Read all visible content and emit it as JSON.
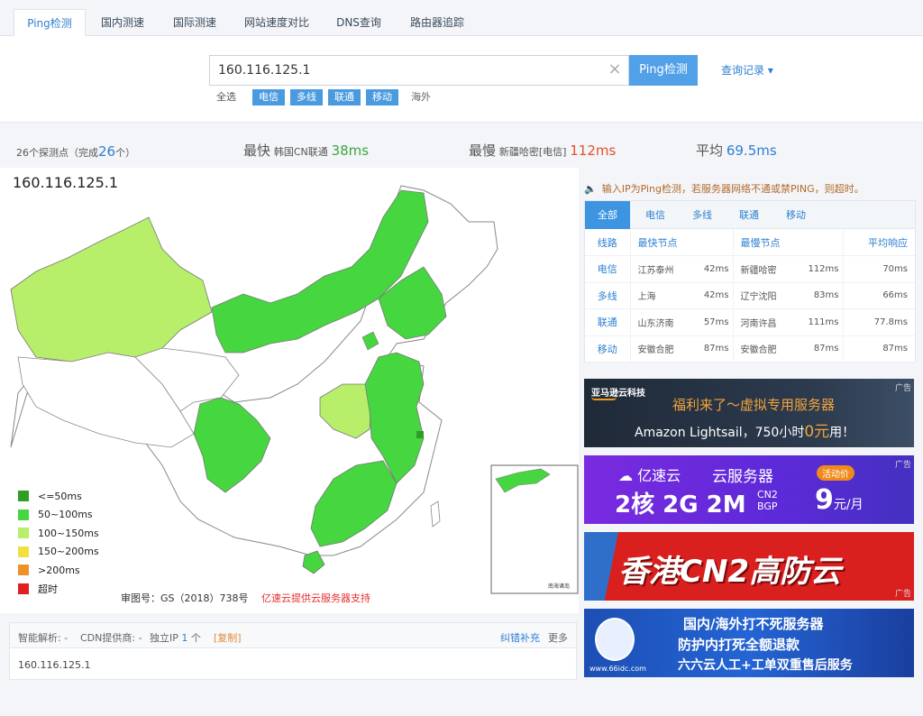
{
  "tabs": [
    "Ping检测",
    "国内测速",
    "国际测速",
    "网站速度对比",
    "DNS查询",
    "路由器追踪"
  ],
  "search": {
    "value": "160.116.125.1",
    "clear": "×",
    "button": "Ping检测",
    "history": "查询记录 ▾"
  },
  "filters": [
    "全选",
    "电信",
    "多线",
    "联通",
    "移动",
    "海外"
  ],
  "stats": {
    "probe_prefix": "26个探测点（完成",
    "probe_done": "26",
    "probe_suffix": "个）",
    "fastest_label": "最快",
    "fastest_node": "韩国CN联通",
    "fastest_value": "38ms",
    "slowest_label": "最慢",
    "slowest_node": "新疆哈密[电信]",
    "slowest_value": "112ms",
    "avg_label": "平均",
    "avg_value": "69.5ms"
  },
  "map": {
    "ip": "160.116.125.1",
    "legend": [
      {
        "label": "<=50ms",
        "color": "#2e9e26"
      },
      {
        "label": "50~100ms",
        "color": "#45d640"
      },
      {
        "label": "100~150ms",
        "color": "#b8ef6a"
      },
      {
        "label": "150~200ms",
        "color": "#f0e040"
      },
      {
        "label": ">200ms",
        "color": "#f0902a"
      },
      {
        "label": "超时",
        "color": "#e02020"
      }
    ],
    "approval": "审图号：GS（2018）738号",
    "powered": "亿速云提供云服务器支持",
    "island_label": "南海诸岛"
  },
  "ipinfo": {
    "smart": "智能解析: -",
    "cdn": "CDN提供商: -",
    "ip_prefix": "独立IP",
    "ip_count": "1",
    "ip_suffix": "个",
    "copy": "[复制]",
    "report": "纠错补充",
    "more": "更多",
    "ip": "160.116.125.1"
  },
  "notice": "输入IP为Ping检测，若服务器网络不通或禁PING，则超时。",
  "results": {
    "tabs": [
      "全部",
      "电信",
      "多线",
      "联通",
      "移动"
    ],
    "headers": {
      "line": "线路",
      "fast": "最快节点",
      "slow": "最慢节点",
      "avg": "平均响应"
    },
    "rows": [
      {
        "line": "电信",
        "fast_node": "江苏泰州",
        "fast_ms": "42ms",
        "slow_node": "新疆哈密",
        "slow_ms": "112ms",
        "avg": "70ms"
      },
      {
        "line": "多线",
        "fast_node": "上海",
        "fast_ms": "42ms",
        "slow_node": "辽宁沈阳",
        "slow_ms": "83ms",
        "avg": "66ms"
      },
      {
        "line": "联通",
        "fast_node": "山东济南",
        "fast_ms": "57ms",
        "slow_node": "河南许昌",
        "slow_ms": "111ms",
        "avg": "77.8ms"
      },
      {
        "line": "移动",
        "fast_node": "安徽合肥",
        "fast_ms": "87ms",
        "slow_node": "安徽合肥",
        "slow_ms": "87ms",
        "avg": "87ms"
      }
    ]
  },
  "ads": [
    {
      "brand": "亚马逊云科技",
      "line1": "福利来了～虚拟专用服务器",
      "line2a": "Amazon Lightsail，750小时",
      "line2b": "0元",
      "line2c": "用！",
      "tag": "广告"
    },
    {
      "brand": "亿速云",
      "product": "云服务器",
      "badge": "活动价",
      "spec": "2核 2G 2M",
      "net1": "CN2",
      "net2": "BGP",
      "price": "9",
      "unit": "元/月",
      "tag": "广告"
    },
    {
      "text": "香港CN2高防云",
      "tag": "广告"
    },
    {
      "line1": "国内/海外打不死服务器",
      "line2": "防护内打死全额退款",
      "line3": "六六云人工+工单双重售后服务",
      "url": "www.66idc.com"
    }
  ]
}
